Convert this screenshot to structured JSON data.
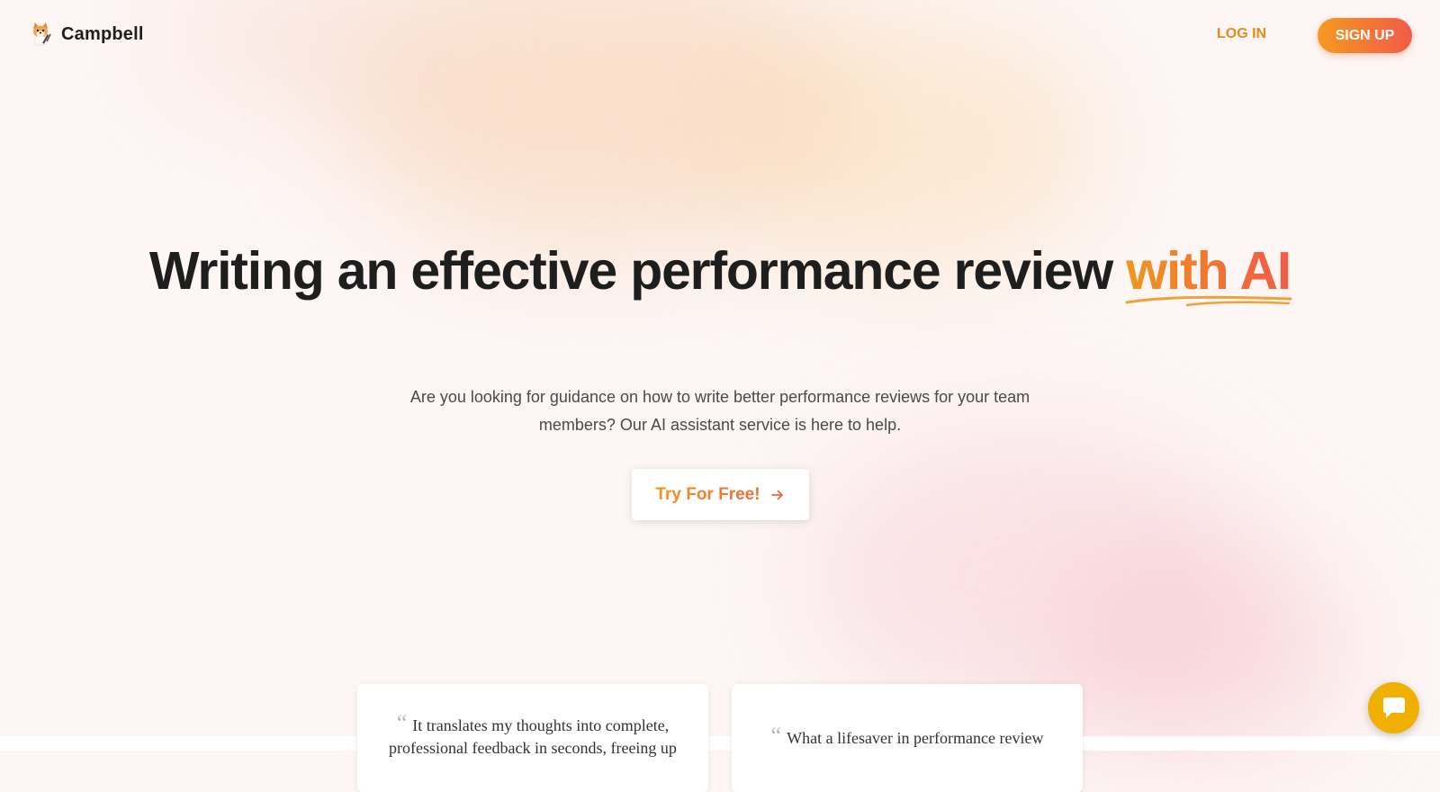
{
  "brand": {
    "name": "Campbell",
    "logo_icon": "dog-mascot-icon"
  },
  "nav": {
    "login_label": "LOG IN",
    "signup_label": "SIGN UP"
  },
  "hero": {
    "title_main": "Writing an effective performance review ",
    "title_accent": "with AI",
    "subtitle": "Are you looking for guidance on how to write better performance reviews for your team members? Our AI assistant service is here to help.",
    "cta_label": "Try For Free!",
    "cta_icon": "arrow-right-icon"
  },
  "testimonials": [
    {
      "quote": "It translates my thoughts into complete, professional feedback in seconds, freeing up"
    },
    {
      "quote": "What a lifesaver in performance review"
    }
  ],
  "chat": {
    "icon": "chat-bubble-icon"
  },
  "colors": {
    "accent_orange": "#f0961e",
    "accent_red": "#ef5c4a",
    "chat_yellow": "#f0b000",
    "background": "#fdf6f5"
  }
}
